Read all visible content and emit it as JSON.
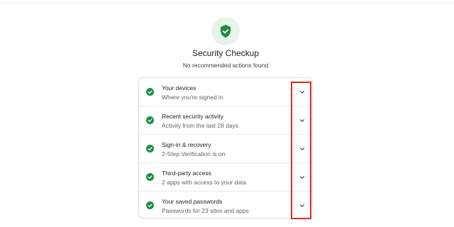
{
  "header": {
    "title": "Security Checkup",
    "subtitle": "No recommended actions found"
  },
  "colors": {
    "accent_green": "#1e8e3e",
    "badge_bg": "#e6f4ea",
    "highlight_red": "#e02a1f"
  },
  "icons": {
    "hero": "shield-check-icon",
    "row_status": "check-circle-icon",
    "row_expand": "chevron-down-icon"
  },
  "items": [
    {
      "title": "Your devices",
      "description": "Where you're signed in"
    },
    {
      "title": "Recent security activity",
      "description": "Activity from the last 28 days"
    },
    {
      "title": "Sign-in & recovery",
      "description": "2-Step Verification is on"
    },
    {
      "title": "Third-party access",
      "description": "2 apps with access to your data"
    },
    {
      "title": "Your saved passwords",
      "description": "Passwords for 23 sites and apps"
    }
  ]
}
